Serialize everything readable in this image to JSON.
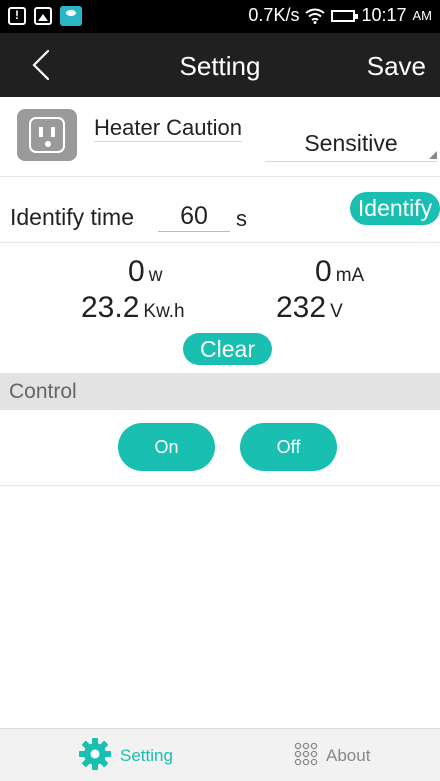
{
  "status_bar": {
    "speed": "0.7K/s",
    "time": "10:17",
    "ampm": "AM"
  },
  "header": {
    "title": "Setting",
    "save_label": "Save",
    "back_icon": "back-chevron-icon"
  },
  "device": {
    "name": "Heater Caution",
    "mode": "Sensitive",
    "icon": "power-outlet-icon"
  },
  "identify": {
    "label": "Identify time",
    "value": "60",
    "unit": "s",
    "button_label": "Identify"
  },
  "readings": {
    "power": {
      "value": "0",
      "unit": "w"
    },
    "current": {
      "value": "0",
      "unit": "mA"
    },
    "energy": {
      "value": "23.2",
      "unit": "Kw.h"
    },
    "voltage": {
      "value": "232",
      "unit": "V"
    },
    "clear_label": "Clear"
  },
  "control": {
    "header": "Control",
    "on_label": "On",
    "off_label": "Off"
  },
  "bottom_nav": {
    "setting_label": "Setting",
    "about_label": "About"
  },
  "colors": {
    "accent": "#19bfb0",
    "header_bg": "#202020",
    "status_bg": "#000000"
  }
}
